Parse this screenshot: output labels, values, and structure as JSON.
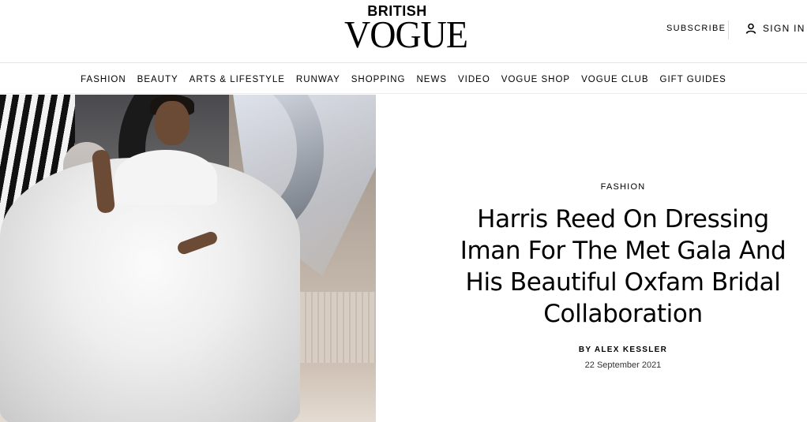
{
  "header": {
    "logo_top": "BRITISH",
    "logo_main": "VOGUE",
    "subscribe_label": "SUBSCRIBE",
    "signin_label": "SIGN IN",
    "signin_icon": "user-icon"
  },
  "nav": {
    "items": [
      {
        "label": "FASHION"
      },
      {
        "label": "BEAUTY"
      },
      {
        "label": "ARTS & LIFESTYLE"
      },
      {
        "label": "RUNWAY"
      },
      {
        "label": "SHOPPING"
      },
      {
        "label": "NEWS"
      },
      {
        "label": "VIDEO"
      },
      {
        "label": "VOGUE SHOP"
      },
      {
        "label": "VOGUE CLUB"
      },
      {
        "label": "GIFT GUIDES"
      }
    ]
  },
  "article": {
    "category": "FASHION",
    "headline": "Harris Reed On Dressing Iman For The Met Gala And His Beautiful Oxfam Bridal Collaboration",
    "byline_prefix": "BY ",
    "author": "ALEX KESSLER",
    "date": "22 September 2021"
  },
  "colors": {
    "text": "#000000",
    "divider": "#e6e6e6",
    "background": "#ffffff"
  }
}
